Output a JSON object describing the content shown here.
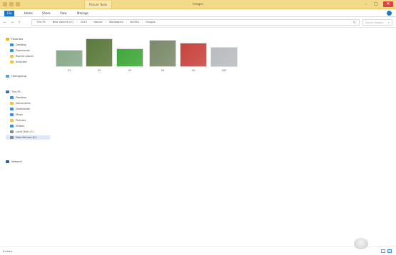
{
  "window": {
    "title": "Images",
    "contextual_tab": "Picture Tools",
    "minimize": "–",
    "maximize": "□",
    "close": "✕"
  },
  "ribbon": {
    "tabs": [
      "File",
      "Home",
      "Share",
      "View",
      "Manage"
    ]
  },
  "address": {
    "crumbs": [
      "This PC",
      "New Volume (E:)",
      "2015",
      "Nature",
      "Wallpapers",
      "BOOKS",
      "Images"
    ],
    "search_placeholder": "Search Images",
    "search_icon": "search-icon",
    "refresh_glyph": "↻"
  },
  "navigation": {
    "back": "←",
    "forward": "→",
    "up": "↑",
    "quick_access_label": "Favorites",
    "quick_access": [
      "Desktop",
      "Downloads",
      "Recent places",
      "Selected"
    ],
    "homegroup": "Homegroup",
    "this_pc": "This PC",
    "this_pc_items": [
      "Desktop",
      "Documents",
      "Downloads",
      "Music",
      "Pictures",
      "Videos",
      "Local Disk (C:)",
      "New Volume (E:)"
    ],
    "network": "Network"
  },
  "files": [
    {
      "name": "01",
      "color": "#88a98a",
      "img_h": 24
    },
    {
      "name": "02",
      "color": "#5b7a3a",
      "img_h": 40
    },
    {
      "name": "03",
      "color": "#3fa83a",
      "img_h": 26
    },
    {
      "name": "04",
      "color": "#7b8a6a",
      "img_h": 38
    },
    {
      "name": "05",
      "color": "#c8433e",
      "img_h": 34
    },
    {
      "name": "005",
      "color": "#b9bcbf",
      "img_h": 28
    }
  ],
  "status": {
    "items": "6 items"
  }
}
